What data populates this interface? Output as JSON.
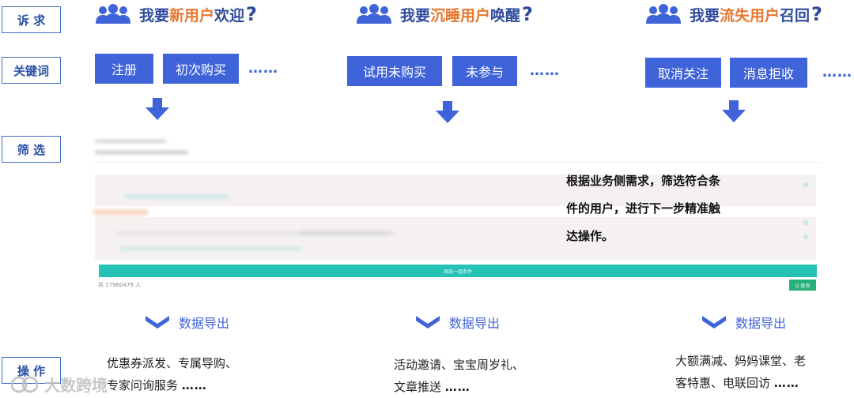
{
  "labels": {
    "appeal": "诉 求",
    "keywords": "关键词",
    "filter": "筛 选",
    "operation": "操 作"
  },
  "columns": [
    {
      "head_prefix": "我要",
      "head_highlight": "新用户",
      "head_suffix": "欢迎",
      "question": "?",
      "keywords": [
        "注册",
        "初次购买"
      ],
      "more": "……",
      "export": "数据导出",
      "ops_line1": "优惠券派发、专属导购、",
      "ops_line2": "专家问询服务",
      "ops_more": "……"
    },
    {
      "head_prefix": "我要",
      "head_highlight": "沉睡用户",
      "head_suffix": "唤醒",
      "question": "?",
      "keywords": [
        "试用未购买",
        "未参与"
      ],
      "more": "……",
      "export": "数据导出",
      "ops_line1": "活动邀请、宝宝周岁礼、",
      "ops_line2": "文章推送",
      "ops_more": "……"
    },
    {
      "head_prefix": "我要",
      "head_highlight": "流失用户",
      "head_suffix": "召回",
      "question": "?",
      "keywords": [
        "取消关注",
        "消息拒收"
      ],
      "more": "……",
      "export": "数据导出",
      "ops_line1": "大额满减、妈妈课堂、老",
      "ops_line2": "客特惠、电联回访",
      "ops_more": "……"
    }
  ],
  "filter_panel": {
    "note_line1": "根据业务侧需求，筛选符合条",
    "note_line2": "件的用户，进行下一步精准触",
    "note_line3": "达操作。",
    "add_condition": "添加一组条件",
    "count_text": "共 17960479 人",
    "query_button": "Q 查询"
  },
  "watermark": "大数跨境",
  "colors": {
    "primary": "#3f63d9",
    "accent": "#e8772e",
    "teal": "#2ec4b6",
    "label_border": "#3d6fc8"
  }
}
